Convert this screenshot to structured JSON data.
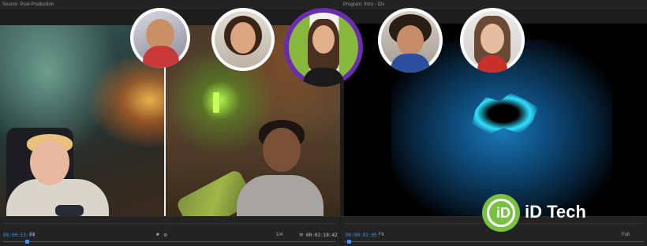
{
  "source_monitor": {
    "title": "Source: Post-Production",
    "timecode_current": "00:00:13:04",
    "fit_label": "Fit",
    "quality": "1/4",
    "timecode_duration": "00:02:18:42"
  },
  "program_monitor": {
    "title": "Program: Intro - iDs",
    "timecode_current": "00:00:02:05",
    "fit_label": "Fit",
    "quality": "Full"
  },
  "participants": [
    {
      "name": "participant-1"
    },
    {
      "name": "participant-2"
    },
    {
      "name": "participant-3-speaker"
    },
    {
      "name": "participant-4"
    },
    {
      "name": "participant-5"
    }
  ],
  "logo": {
    "glyph": "iD",
    "text": "iD Tech",
    "color": "#7ac143"
  },
  "colors": {
    "accent": "#3c96f0",
    "speaker_ring": "#6a2db0"
  }
}
